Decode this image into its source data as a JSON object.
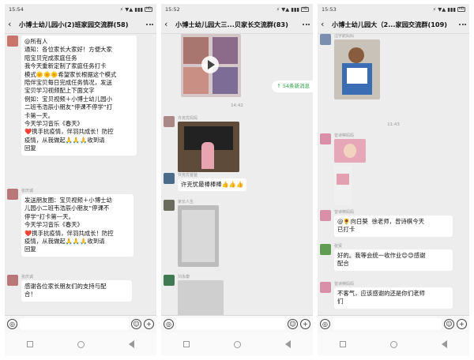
{
  "status": {
    "p1_time": "15:54",
    "p2_time": "15:52",
    "p3_time": "15:53",
    "right": "⚡ ▼▲ ▮▮▮",
    "battery": "HD"
  },
  "p1": {
    "title": "小博士幼儿园小(2)班家园交流群(58)",
    "msg1": "@所有人\n通知：各位家长大家好！方便大家\n陪宝贝完成家庭任务\n我今天重新定制了家庭任务打卡\n模式🌞🌞🌞希望家长根据这个模式\n陪伴宝贝每日完成任务情况，发送\n宝贝学习视频配上下面文字\n例如：宝贝视频＋小博士幼儿园小\n二班韦浩辰小朋友”停课不停学“打\n卡第一天。\n今天学习音乐《春天》\n❤️携手抗疫情，伴羽共成长！防控\n疫情，从我做起🙏🙏🙏收到请\n回复",
    "name2": "张庆诚",
    "msg2": "发送朋友圈：宝贝视频＋小博士幼\n儿园小二班韦浩辰小朋友”停课不\n停学“打卡第一天。\n今天学习音乐《春天》\n❤️携手抗疫情，伴羽共成长！防控\n疫情，从我做起🙏🙏🙏收到请\n回复",
    "name3": "张庆诚",
    "msg3": "感谢各位家长朋友们的支持与配\n合！"
  },
  "p2": {
    "title": "小博士幼儿园大三...贝家长交流群(83)",
    "new_badge": "↑ 54条新消息",
    "time1": "14:42",
    "name_a": "许克忧妈妈",
    "name_b": "许克忧爸爸",
    "msg_b": "许克忧最棒棒棒👍👍👍",
    "name_c": "家长人生",
    "name_d": "刘永康"
  },
  "p3": {
    "title": "小博士幼儿园大（2...家园交流群(109)",
    "name_a": "汪宇航妈妈",
    "time1": "11:43",
    "name_b": "曾诗棋妈妈",
    "name_c": "曾诗棋妈妈",
    "msg_c": "@🌻向日葵  徐老师，曾诗棋今天\n已打卡",
    "name_d": "张贤",
    "msg_d": "好的。我等会统一收作业😊😊感谢\n配合",
    "name_e": "曾诗棋妈妈",
    "msg_e": "不客气，应该感谢的还是你们老师\n们"
  },
  "icons": {
    "voice": "◎",
    "emoji": "☺",
    "plus": "+"
  }
}
